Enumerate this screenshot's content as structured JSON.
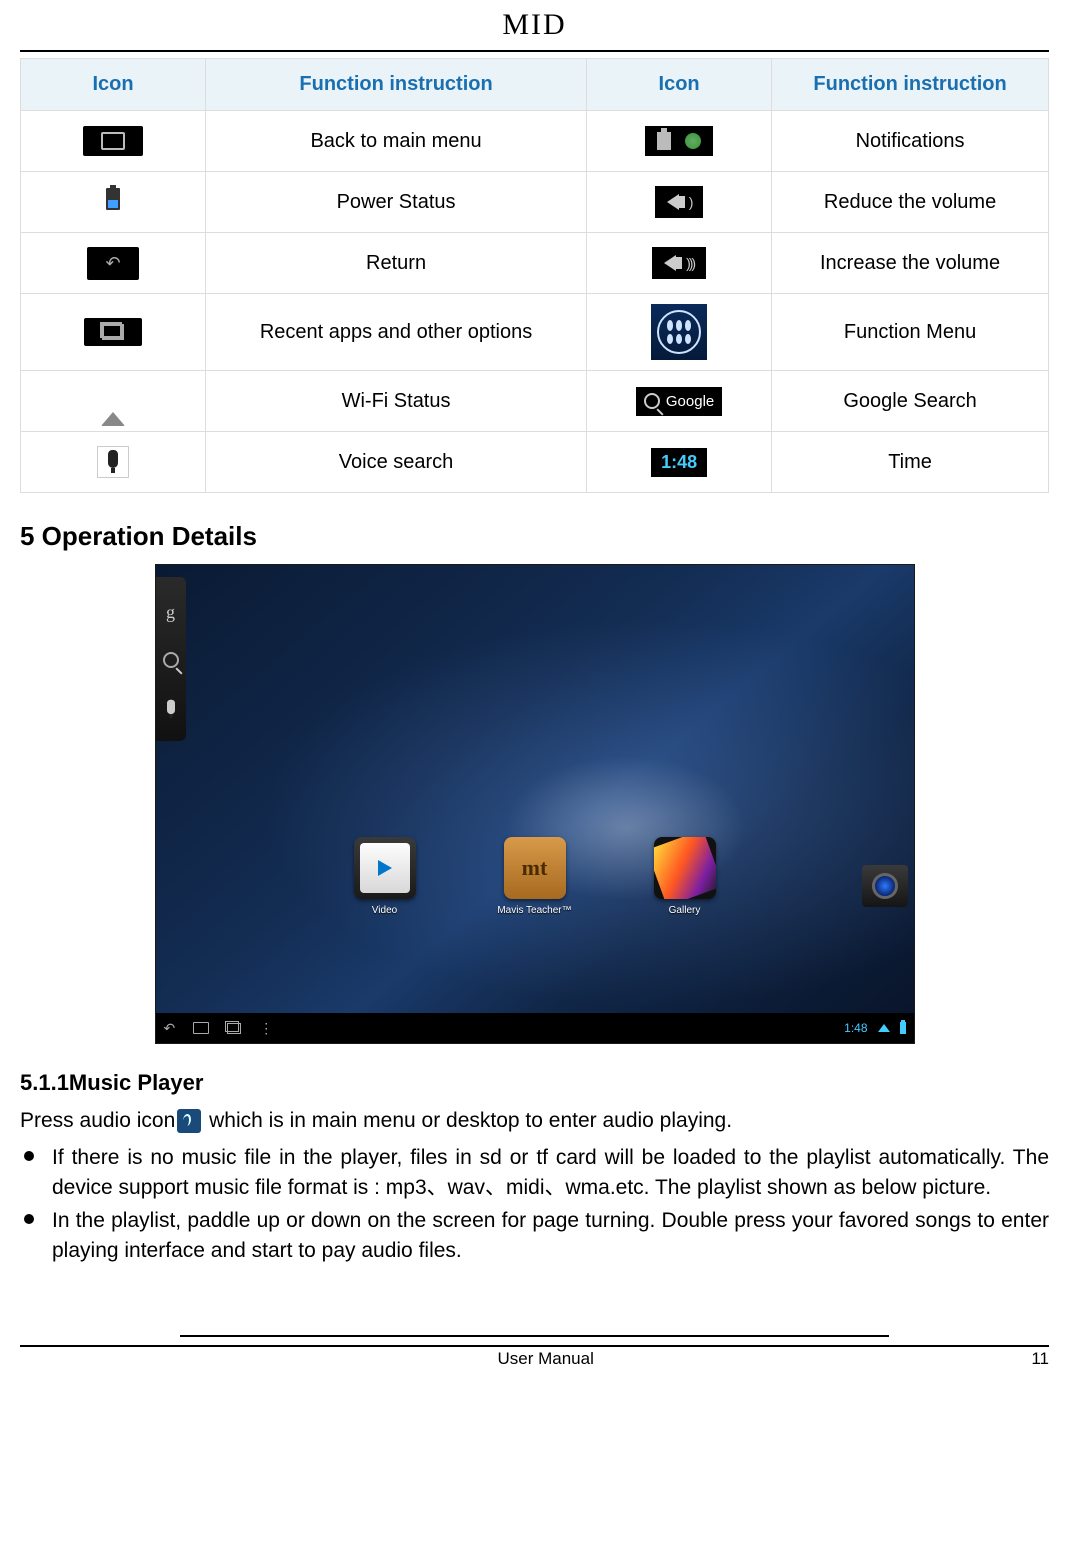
{
  "header": {
    "title": "MID"
  },
  "table": {
    "headers": [
      "Icon",
      "Function instruction",
      "Icon",
      "Function instruction"
    ],
    "rows": [
      {
        "left_desc": "Back to main menu",
        "right_desc": "Notifications",
        "right_red": false
      },
      {
        "left_desc": "Power Status",
        "right_desc": "Reduce the volume",
        "right_red": true
      },
      {
        "left_desc": "Return",
        "right_desc": "Increase the volume",
        "right_red": false
      },
      {
        "left_desc": "Recent apps and other options",
        "right_desc": "Function Menu",
        "right_red": true
      },
      {
        "left_desc": "Wi-Fi Status",
        "right_desc": "Google Search",
        "right_red": false
      },
      {
        "left_desc": "Voice search",
        "right_desc": "Time",
        "right_red": false
      }
    ],
    "time_sample": "1:48",
    "google_word": "Google"
  },
  "section": {
    "heading": "5 Operation Details",
    "sub_heading": "5.1.1Music Player"
  },
  "screenshot": {
    "apps": [
      {
        "label": "Video"
      },
      {
        "label": "Mavis Teacher™"
      },
      {
        "label": "Gallery"
      }
    ],
    "clock": "1:48"
  },
  "body": {
    "press_line_a": "Press audio icon",
    "press_line_b": " which is in main menu or desktop to enter audio playing.",
    "bullet1": "If there is no music file in the player, files in sd or tf card will be loaded to the playlist automatically. The device support music file format is : mp3、wav、midi、wma.etc. The playlist shown as below picture.",
    "bullet2": "In the playlist, paddle up or down on the screen for page turning. Double press your favored songs to enter playing interface and start to pay audio files."
  },
  "footer": {
    "center": "User Manual",
    "page": "11"
  }
}
